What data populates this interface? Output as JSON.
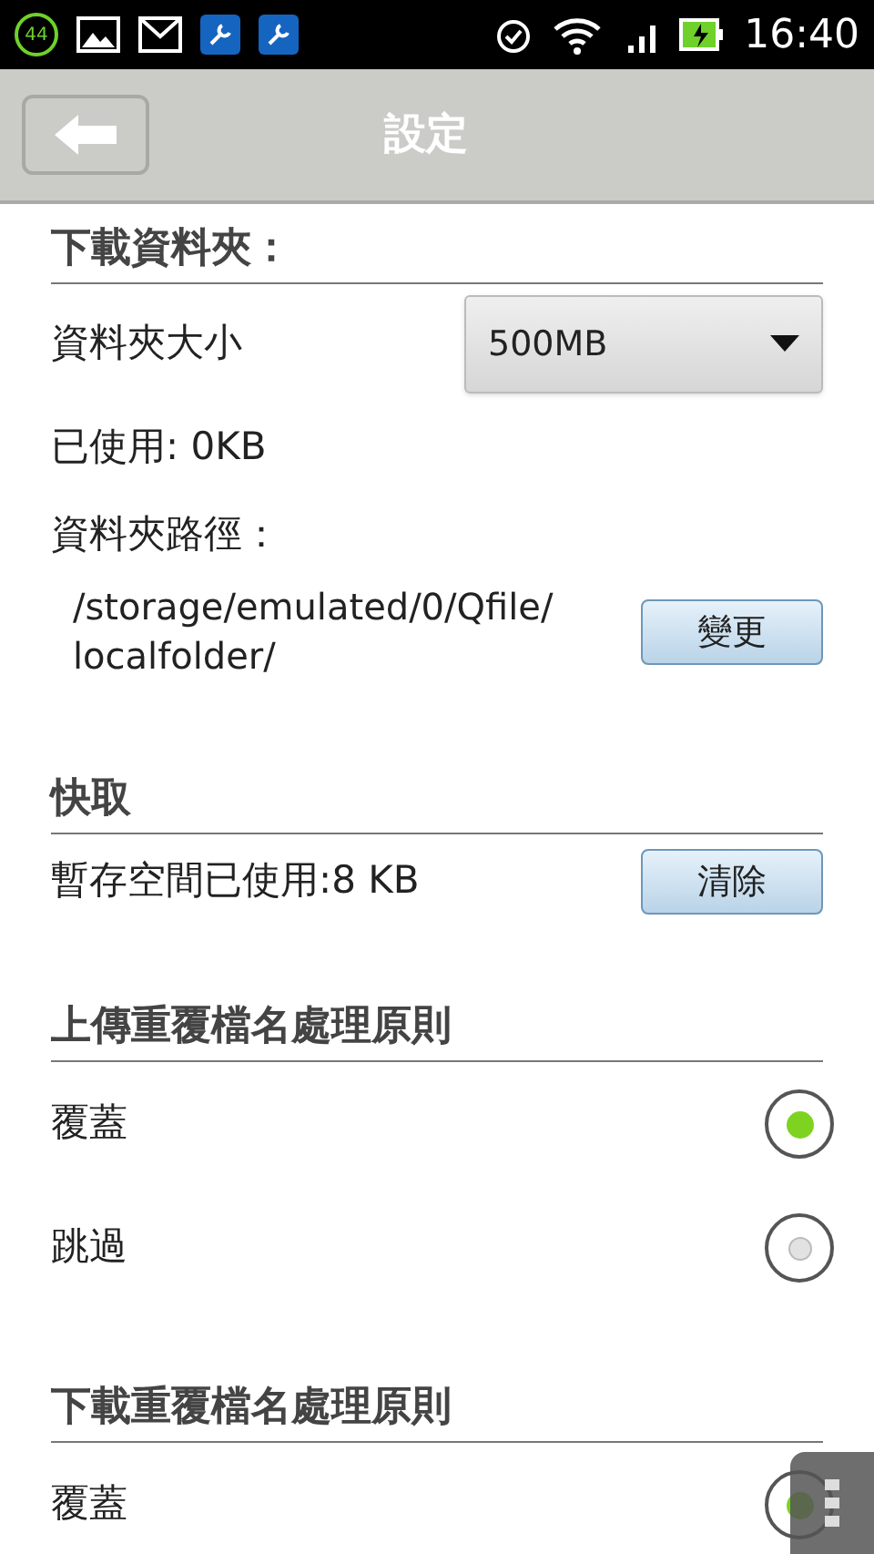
{
  "status_bar": {
    "notification_count": "44",
    "time": "16:40"
  },
  "header": {
    "title": "設定"
  },
  "sections": [
    {
      "title": "下載資料夾：",
      "items": [
        {
          "kind": "dropdown",
          "label": "資料夾大小",
          "value": "500MB"
        },
        {
          "kind": "text",
          "label": "已使用: 0KB"
        },
        {
          "kind": "text",
          "label": "資料夾路徑："
        },
        {
          "kind": "path",
          "lines": [
            "/storage/emulated/0/Qfile/",
            "localfolder/"
          ],
          "button": "變更"
        }
      ]
    },
    {
      "title": "快取",
      "items": [
        {
          "kind": "action",
          "label": "暫存空間已使用:8 KB",
          "button": "清除"
        }
      ]
    },
    {
      "title": "上傳重覆檔名處理原則",
      "items": [
        {
          "kind": "radio",
          "label": "覆蓋",
          "selected": true
        },
        {
          "kind": "radio",
          "label": "跳過",
          "selected": false
        }
      ]
    },
    {
      "title": "下載重覆檔名處理原則",
      "items": [
        {
          "kind": "radio",
          "label": "覆蓋",
          "selected": true
        }
      ]
    }
  ]
}
